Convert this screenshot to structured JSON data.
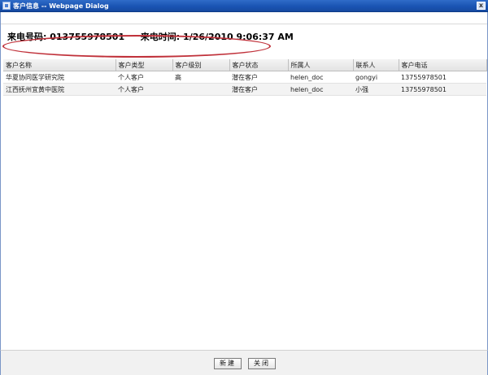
{
  "window": {
    "title": "客户信息 -- Webpage Dialog",
    "close_label": "x"
  },
  "call_info": {
    "number_label": "来电号码:",
    "number_value": "013755978501",
    "time_label": "来电时间:",
    "time_value": "1/26/2010 9:06:37 AM"
  },
  "table": {
    "columns": [
      "客户名称",
      "客户类型",
      "客户级别",
      "客户状态",
      "所属人",
      "联系人",
      "客户电话"
    ],
    "rows": [
      [
        "华夏协同医学研究院",
        "个人客户",
        "高",
        "潜在客户",
        "helen_doc",
        "gongyi",
        "13755978501"
      ],
      [
        "江西抚州宜黄中医院",
        "个人客户",
        "",
        "潜在客户",
        "helen_doc",
        "小强",
        "13755978501"
      ]
    ]
  },
  "footer": {
    "new_label": "新建",
    "close_label": "关闭"
  }
}
